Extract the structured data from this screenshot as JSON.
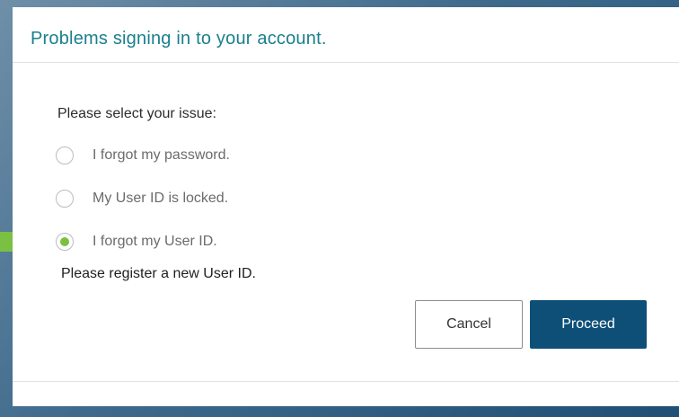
{
  "dialog": {
    "title": "Problems signing in to your account.",
    "prompt": "Please select your issue:",
    "options": [
      {
        "label": "I forgot my password.",
        "selected": false
      },
      {
        "label": "My User ID is locked.",
        "selected": false
      },
      {
        "label": "I forgot my User ID.",
        "selected": true
      }
    ],
    "note": "Please register a new User ID.",
    "buttons": {
      "cancel_label": "Cancel",
      "proceed_label": "Proceed"
    }
  },
  "colors": {
    "title": "#1a7f8e",
    "primary_button": "#0e4f78",
    "radio_selected": "#7ac143",
    "arrow": "#7ac143"
  },
  "annotation": {
    "arrow_icon": "green-arrow-right-icon"
  }
}
